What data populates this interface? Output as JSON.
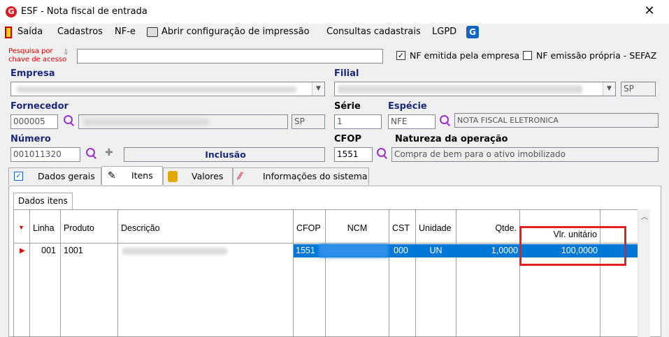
{
  "window": {
    "title": "ESF - Nota fiscal de entrada"
  },
  "menu": {
    "items": [
      "Saída",
      "Cadastros",
      "NF-e",
      "Abrir configuração de impressão",
      "Consultas cadastrais",
      "LGPD"
    ]
  },
  "search": {
    "label_line1": "Pesquisa por",
    "label_line2": "chave de acesso",
    "value": "",
    "nf_emitida_label": "NF emitida pela empresa",
    "nf_emitida_checked": true,
    "nf_propria_label": "NF emissão própria - SEFAZ",
    "nf_propria_checked": false
  },
  "empresa": {
    "label": "Empresa"
  },
  "filial": {
    "label": "Filial",
    "uf": "SP"
  },
  "fornecedor": {
    "label": "Fornecedor",
    "code": "000005",
    "uf": "SP"
  },
  "serie": {
    "label": "Série",
    "value": "1"
  },
  "especie": {
    "label": "Espécie",
    "code": "NFE",
    "description": "NOTA FISCAL ELETRONICA"
  },
  "numero": {
    "label": "Número",
    "value": "001011320",
    "status": "Inclusão"
  },
  "cfop": {
    "label": "CFOP",
    "value": "1551"
  },
  "natureza": {
    "label": "Natureza da operação",
    "value": "Compra de bem para o ativo imobilizado"
  },
  "tabs": [
    {
      "label": "Dados gerais",
      "icon": "checkbox-icon"
    },
    {
      "label": "Itens",
      "icon": "edit-icon"
    },
    {
      "label": "Valores",
      "icon": "coins-icon"
    },
    {
      "label": "Informações do sistema",
      "icon": "feather-icon"
    }
  ],
  "subtab": {
    "label": "Dados itens"
  },
  "grid": {
    "columns": [
      "Linha",
      "Produto",
      "Descrição",
      "CFOP",
      "NCM",
      "CST",
      "Unidade",
      "Qtde.",
      "Vlr. unitário"
    ],
    "rows": [
      {
        "linha": "001",
        "produto": "1001",
        "descricao": "",
        "cfop": "1551",
        "ncm": "",
        "cst": "000",
        "unidade": "UN",
        "qtde": "1,0000",
        "vlr_unitario": "100,0000"
      }
    ]
  },
  "colors": {
    "selection": "#0078d7",
    "highlight_box": "#e32020",
    "label_blue": "#1a2a7a",
    "label_red": "#e00000"
  }
}
